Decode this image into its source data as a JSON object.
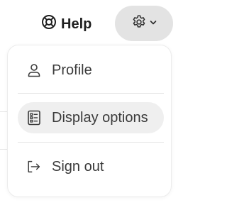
{
  "header": {
    "help_label": "Help",
    "help_icon": "lifebuoy-icon",
    "settings_icon": "gear-icon",
    "settings_chevron_icon": "chevron-down-icon"
  },
  "menu": {
    "items": [
      {
        "label": "Profile",
        "icon": "user-icon",
        "active": false
      },
      {
        "label": "Display options",
        "icon": "list-settings-icon",
        "active": true
      },
      {
        "label": "Sign out",
        "icon": "sign-out-icon",
        "active": false
      }
    ]
  },
  "colors": {
    "settings_button_bg": "#e3e3e3",
    "active_item_bg": "#efefef",
    "text": "#3a3a3a"
  }
}
